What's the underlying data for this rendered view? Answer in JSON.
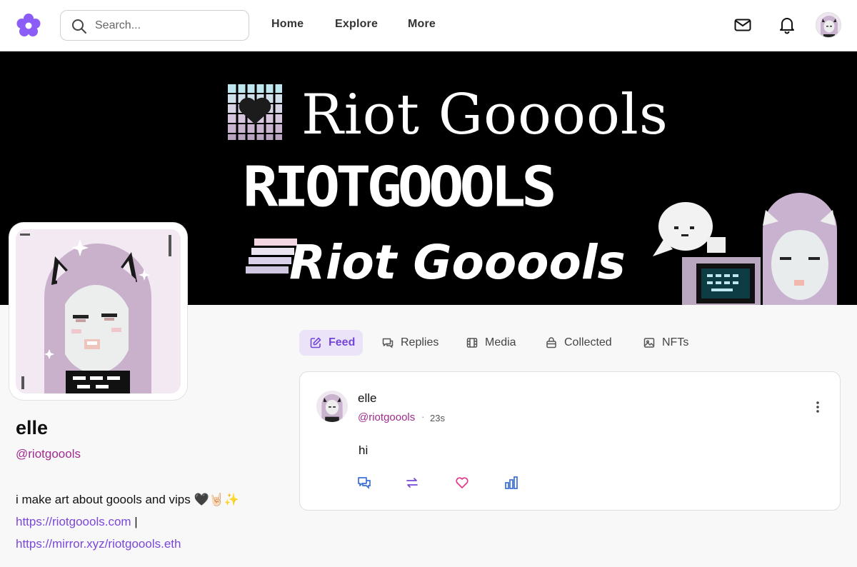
{
  "app": {
    "logo_icon": "flower-icon",
    "accent_color": "#7447d6",
    "handle_color": "#a02c8c"
  },
  "search": {
    "placeholder": "Search..."
  },
  "nav": {
    "links": [
      "Home",
      "Explore",
      "More"
    ],
    "icons": [
      "mail-icon",
      "bell-icon",
      "avatar"
    ]
  },
  "banner": {
    "line1": "Riot Gooools",
    "line2": "RIOTGOOOLS",
    "line3": "Riot Gooools"
  },
  "profile": {
    "name": "elle",
    "handle": "@riotgoools",
    "bio": "i make art about goools and vips 🖤🤘🏻✨",
    "link1": "https://riotgoools.com",
    "separator": " |",
    "link2": "https://mirror.xyz/riotgoools.eth"
  },
  "tabs": [
    {
      "label": "Feed",
      "icon": "pencil-square-icon",
      "active": true
    },
    {
      "label": "Replies",
      "icon": "chat-bubbles-icon",
      "active": false
    },
    {
      "label": "Media",
      "icon": "film-icon",
      "active": false
    },
    {
      "label": "Collected",
      "icon": "bag-icon",
      "active": false
    },
    {
      "label": "NFTs",
      "icon": "image-icon",
      "active": false
    }
  ],
  "post": {
    "author": "elle",
    "handle": "@riotgoools",
    "dot": "·",
    "time": "23s",
    "text": "hi",
    "actions": [
      "comment-icon",
      "mirror-icon",
      "heart-icon",
      "stats-icon"
    ]
  }
}
